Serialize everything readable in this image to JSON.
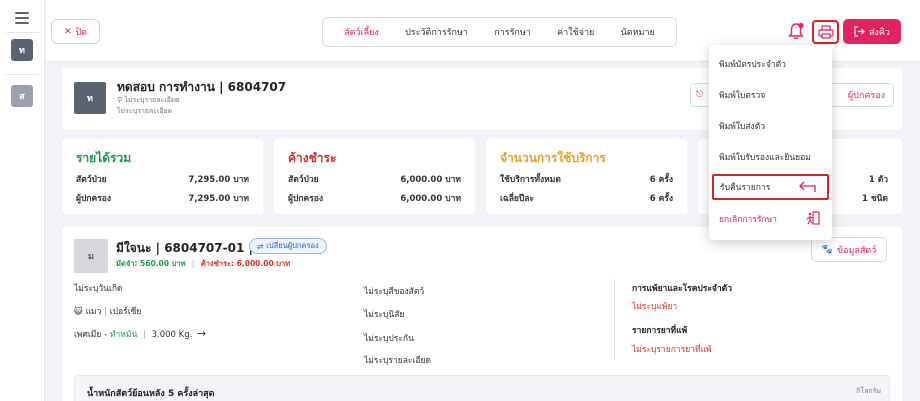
{
  "rail": {
    "box1": "ท",
    "box2": "ส"
  },
  "header": {
    "close_label": "ปิด",
    "tabs": [
      "สัตว์เลี้ยง",
      "ประวัติการรักษา",
      "การรักษา",
      "ค่าใช้จ่าย",
      "นัดหมาย"
    ],
    "send_label": "ส่งคิว"
  },
  "patient": {
    "avatar": "ท",
    "name": "ทดสอบ การทำงาน | 6804707",
    "sub1": "ไม่ระบุรายละเอียด",
    "sub2": "ไม่ระบุรายละเอียด",
    "guardian_btn": "ผู้ปกครอง"
  },
  "summary": {
    "income": {
      "title": "รายได้รวม",
      "rows": [
        {
          "label": "สัตว์ป่วย",
          "value": "7,295.00 บาท"
        },
        {
          "label": "ผู้ปกครอง",
          "value": "7,295.00 บาท"
        }
      ]
    },
    "outstanding": {
      "title": "ค้างชำระ",
      "rows": [
        {
          "label": "สัตว์ป่วย",
          "value": "6,000.00 บาท"
        },
        {
          "label": "ผู้ปกครอง",
          "value": "6,000.00 บาท"
        }
      ]
    },
    "visits": {
      "title": "จำนวนการใช้บริการ",
      "rows": [
        {
          "label": "ใช้บริการทั้งหมด",
          "value": "6 ครั้ง"
        },
        {
          "label": "เฉลี่ยปีละ",
          "value": "6 ครั้ง"
        }
      ]
    },
    "pets": {
      "rows": [
        {
          "value": "1 ตัว"
        },
        {
          "value": "1 ชนิด"
        }
      ]
    }
  },
  "pet": {
    "avatar": "ม",
    "name": "มีใจนะ | 6804707-01 |",
    "change_label": "เปลี่ยนผู้ปกครอง",
    "deposit": "มัดจำ: 560.00 บาท",
    "outstanding": "ค้างชำระ: 6,000.00 บาท",
    "info_btn": "ข้อมูลสัตว์",
    "birth": "ไม่ระบุวันเกิด",
    "species": "แมว",
    "breed": "เปอร์เซีย",
    "sex": "เพศเมีย",
    "neuter": "ทำหมัน",
    "weight": "3.000 Kg.",
    "color": "ไม่ระบุสีของสัตว์",
    "temper": "ไม่ระบุนิสัย",
    "insurance": "ไม่ระบุประกัน",
    "detail": "ไม่ระบุรายละเอียด",
    "allergy_title": "การแพ้ยาและโรคประจำตัว",
    "allergy_value": "ไม่ระบุแพ้ยา",
    "drug_allergy_title": "รายการยาที่แพ้",
    "drug_allergy_value": "ไม่ระบุรายการยาที่แพ้",
    "weight_title": "น้ำหนักสัตว์ย้อนหลัง 5 ครั้งล่าสุด",
    "weight_unit": "กิโลกรัม"
  },
  "dropdown": {
    "items": [
      "พิมพ์บัตรประจำตัว",
      "พิมพ์ใบตรวจ",
      "พิมพ์ใบส่งตัว",
      "พิมพ์ใบรับรองและยินยอม",
      "รับคืนรายการ",
      "ยกเลิกการรักษา"
    ]
  },
  "colors": {
    "accent": "#e0245e",
    "green": "#1a9b4a",
    "orange": "#f0a020",
    "red": "#d32f2f",
    "highlight": "#dd2222"
  }
}
